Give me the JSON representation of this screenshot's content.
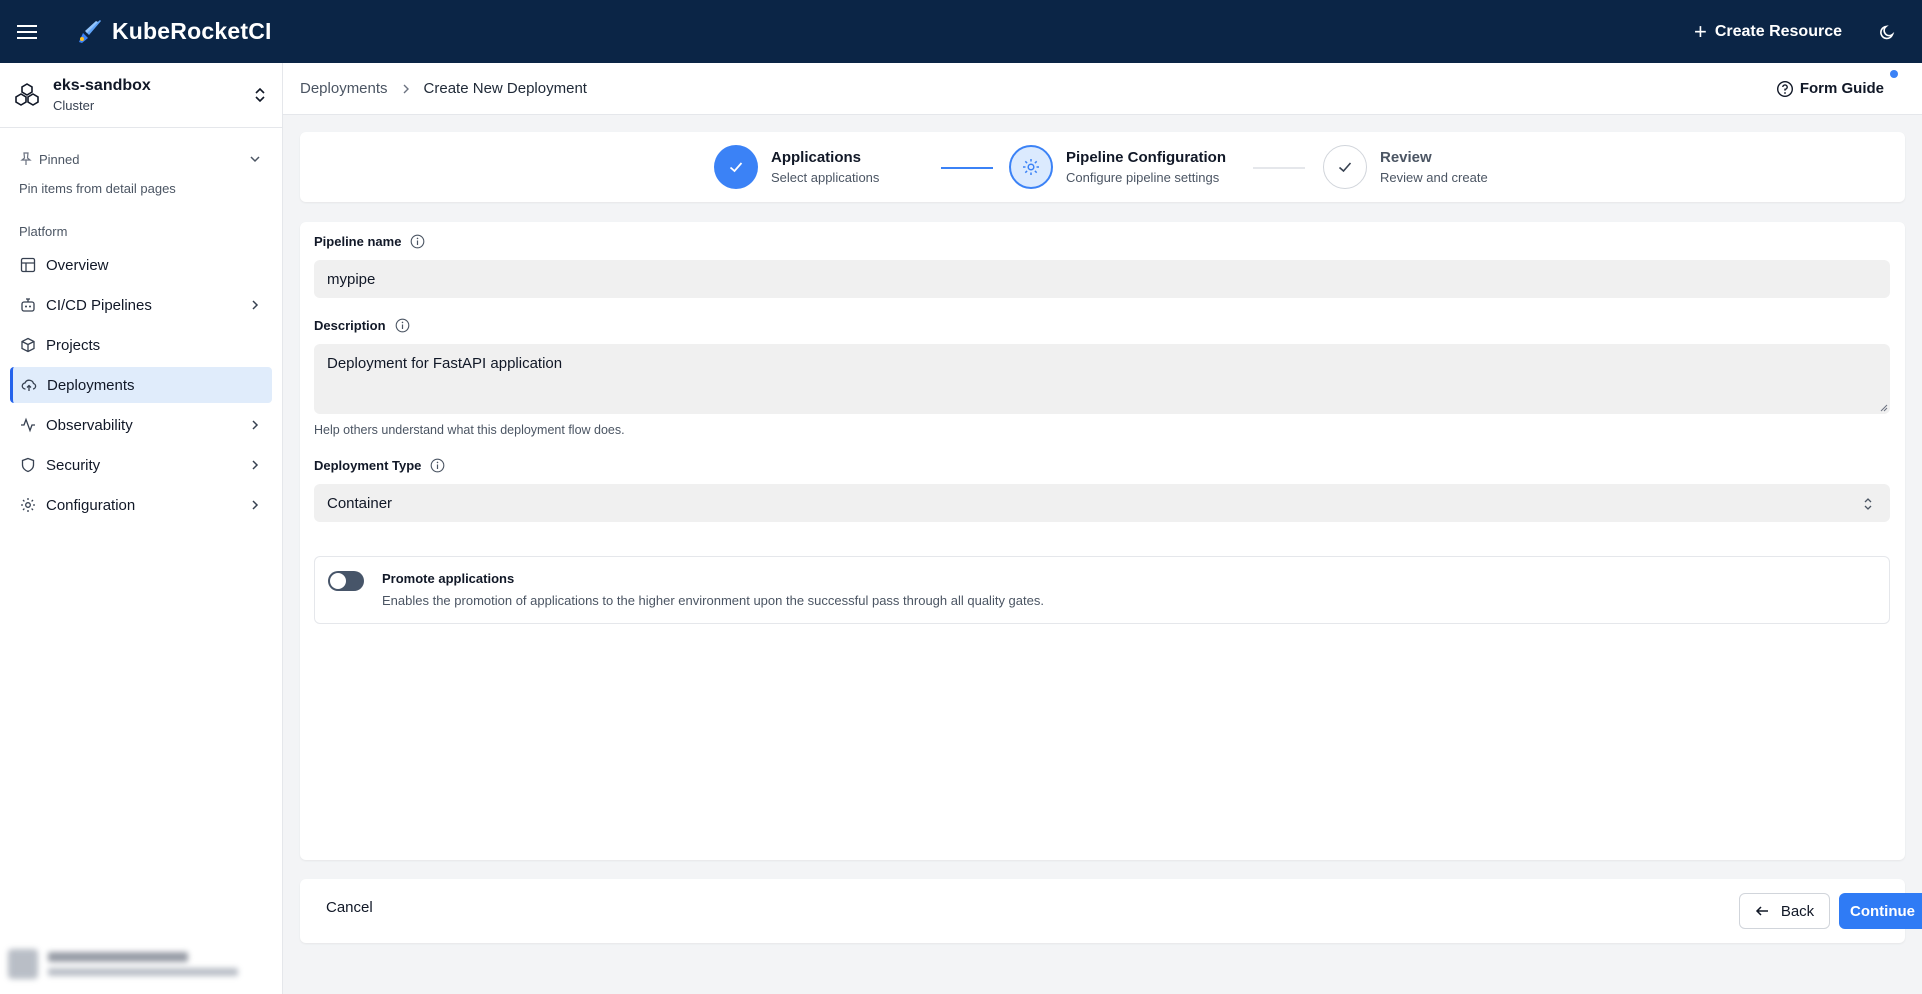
{
  "app": {
    "name": "KubeRocketCI"
  },
  "topbar": {
    "create_resource": "Create Resource",
    "plus_glyph": "+"
  },
  "cluster": {
    "name": "eks-sandbox",
    "type": "Cluster"
  },
  "sidebar": {
    "pinned_label": "Pinned",
    "pin_hint": "Pin items from detail pages",
    "section_title": "Platform",
    "items": [
      {
        "label": "Overview",
        "icon": "overview-icon",
        "has_children": false,
        "active": false
      },
      {
        "label": "CI/CD Pipelines",
        "icon": "bot-icon",
        "has_children": true,
        "active": false
      },
      {
        "label": "Projects",
        "icon": "box-icon",
        "has_children": false,
        "active": false
      },
      {
        "label": "Deployments",
        "icon": "cloud-upload-icon",
        "has_children": false,
        "active": true
      },
      {
        "label": "Observability",
        "icon": "activity-icon",
        "has_children": true,
        "active": false
      },
      {
        "label": "Security",
        "icon": "shield-icon",
        "has_children": true,
        "active": false
      },
      {
        "label": "Configuration",
        "icon": "gear-icon",
        "has_children": true,
        "active": false
      }
    ]
  },
  "breadcrumb": {
    "parent": "Deployments",
    "current": "Create New Deployment"
  },
  "form_guide": "Form Guide",
  "stepper": {
    "steps": [
      {
        "title": "Applications",
        "subtitle": "Select applications",
        "state": "done"
      },
      {
        "title": "Pipeline Configuration",
        "subtitle": "Configure pipeline settings",
        "state": "current"
      },
      {
        "title": "Review",
        "subtitle": "Review and create",
        "state": "pending"
      }
    ]
  },
  "form": {
    "pipeline_name": {
      "label": "Pipeline name",
      "value": "mypipe"
    },
    "description": {
      "label": "Description",
      "value": "Deployment for FastAPI application",
      "helper": "Help others understand what this deployment flow does."
    },
    "deployment_type": {
      "label": "Deployment Type",
      "value": "Container"
    },
    "promote": {
      "title": "Promote applications",
      "description": "Enables the promotion of applications to the higher environment upon the successful pass through all quality gates.",
      "enabled": false
    }
  },
  "footer": {
    "cancel": "Cancel",
    "back": "Back",
    "continue": "Continue"
  },
  "colors": {
    "topbar_bg": "#0b2546",
    "accent": "#2f7bf5",
    "active_nav_bg": "#e0ecfb"
  }
}
